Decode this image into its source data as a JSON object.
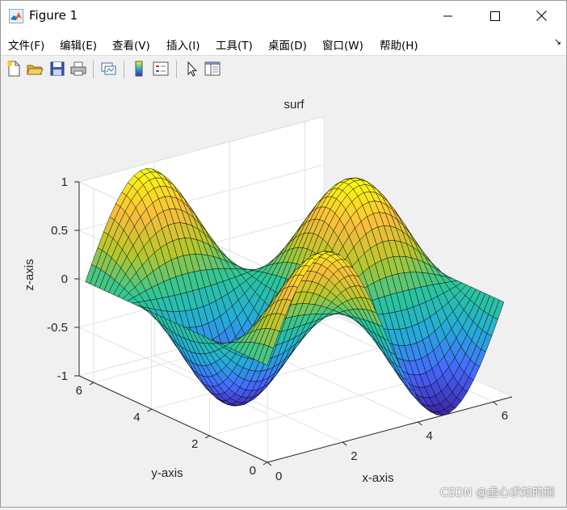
{
  "window": {
    "title": "Figure 1",
    "minimize_icon": "minimize-icon",
    "maximize_icon": "maximize-icon",
    "close_icon": "close-icon"
  },
  "menu": {
    "items": [
      "文件(F)",
      "编辑(E)",
      "查看(V)",
      "插入(I)",
      "工具(T)",
      "桌面(D)",
      "窗口(W)",
      "帮助(H)"
    ],
    "expander": "↘"
  },
  "toolbar": {
    "icons": [
      "new-figure-icon",
      "open-file-icon",
      "save-icon",
      "print-icon",
      "link-plot-icon",
      "colorbar-icon",
      "legend-icon",
      "pointer-icon",
      "property-inspector-icon"
    ]
  },
  "watermark": "CSDN @虚心求知的熊",
  "colors": {
    "colormap": [
      "#3e26a8",
      "#4669fe",
      "#25abd8",
      "#2bc59a",
      "#b5c72c",
      "#f9bd3d",
      "#f9fb0e"
    ],
    "edge": "#000000"
  },
  "chart_data": {
    "type": "surface",
    "title": "surf",
    "xlabel": "x-axis",
    "ylabel": "y-axis",
    "zlabel": "z-axis",
    "function": "z = sin(x) * cos(y)",
    "x_range": [
      0,
      6.2832
    ],
    "y_range": [
      0,
      6.2832
    ],
    "x_points": 40,
    "y_points": 40,
    "xlim": [
      0,
      6.5
    ],
    "ylim": [
      0,
      6.5
    ],
    "zlim": [
      -1,
      1
    ],
    "xticks": [
      0,
      2,
      4,
      6
    ],
    "yticks": [
      0,
      2,
      4,
      6
    ],
    "zticks": [
      -1,
      -0.5,
      0,
      0.5,
      1
    ],
    "xtick_labels": [
      "0",
      "2",
      "4",
      "6"
    ],
    "ytick_labels": [
      "0",
      "2",
      "4",
      "6"
    ],
    "ztick_labels": [
      "-1",
      "-0.5",
      "0",
      "0.5",
      "1"
    ],
    "grid": true,
    "colormap": "parula",
    "shading": "faceted"
  }
}
